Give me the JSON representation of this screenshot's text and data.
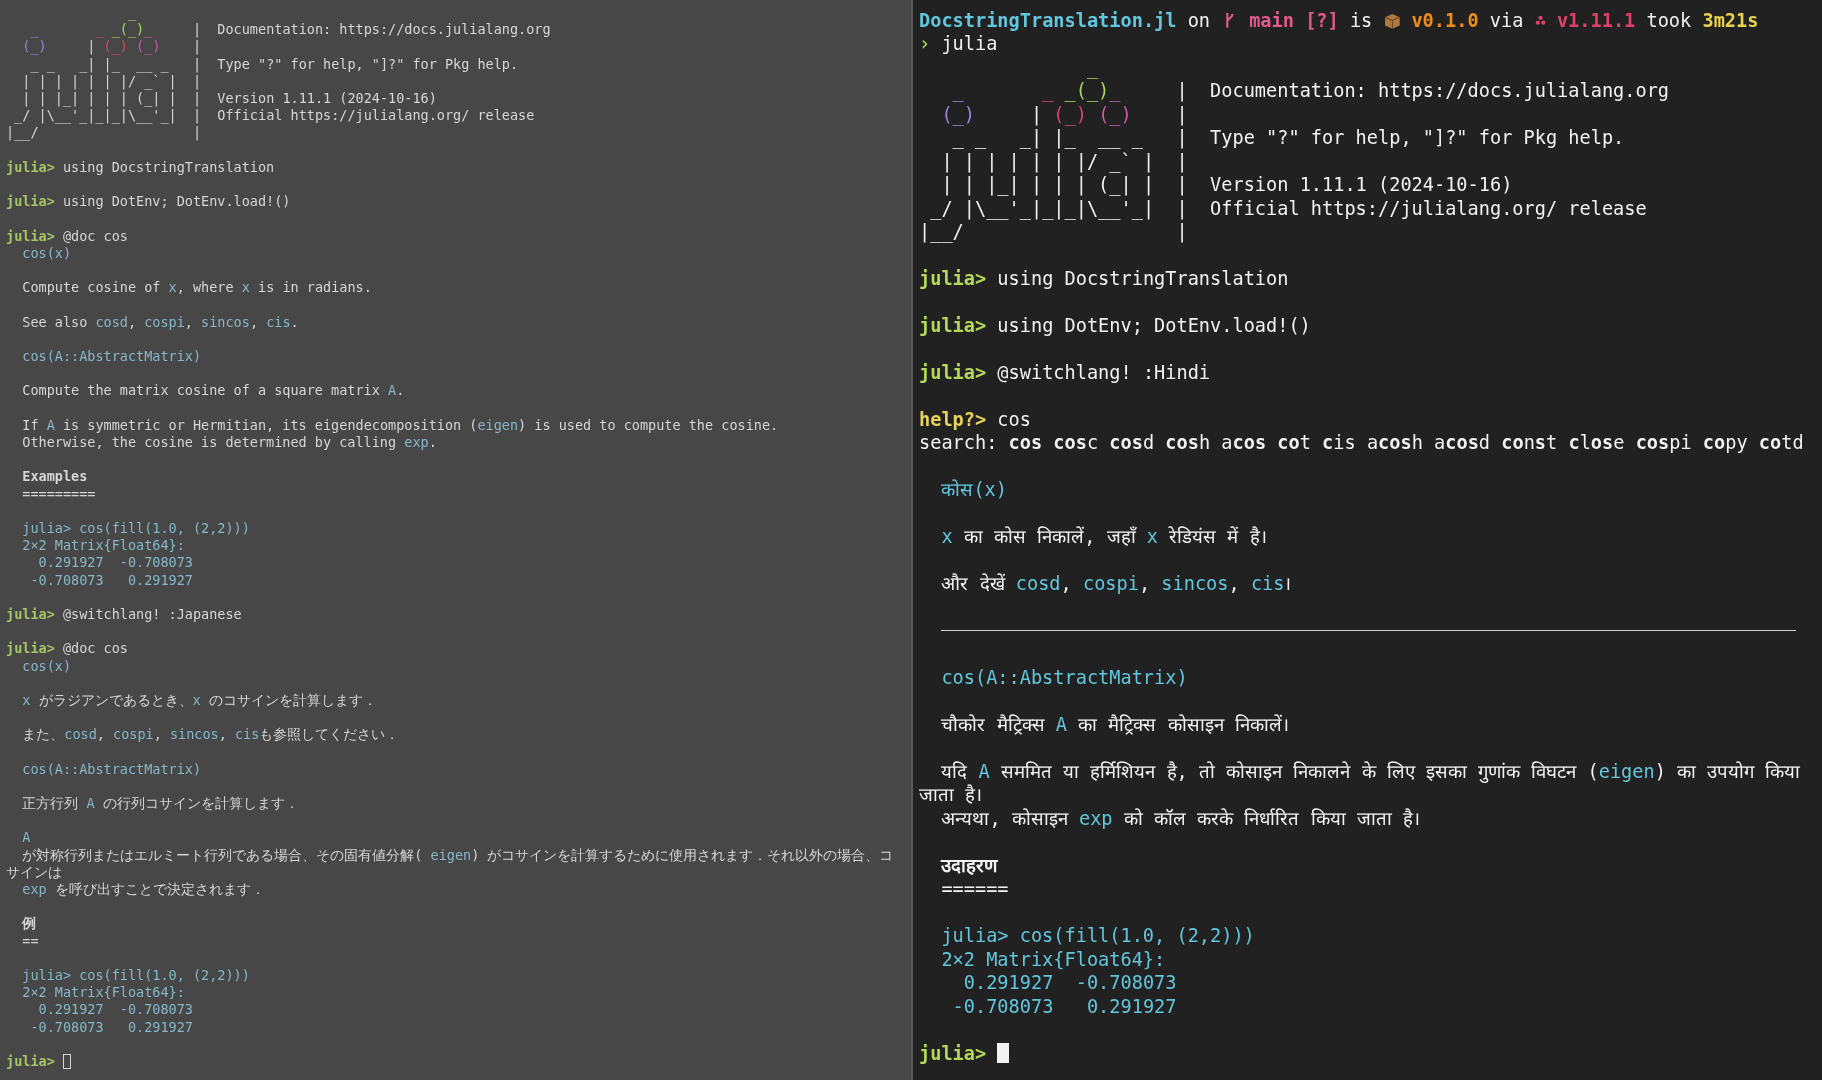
{
  "panes": [
    {
      "focused": false,
      "banner": {
        "art": [
          [
            {
              "kind": "green",
              "text": "               _"
            },
            {
              "kind": "purple",
              "text": "\n   _"
            },
            {
              "kind": "red",
              "text": "       _"
            },
            {
              "kind": "green",
              "text": " _(_)"
            },
            {
              "kind": "magenta",
              "text": "_"
            },
            {
              "kind": "plain",
              "text": "     |"
            }
          ],
          [
            {
              "kind": "purple",
              "text": "  (_)"
            },
            {
              "kind": "plain",
              "text": "     |"
            },
            {
              "kind": "red",
              "text": " (_)"
            },
            {
              "kind": "magenta",
              "text": " (_)"
            },
            {
              "kind": "plain",
              "text": "    |"
            }
          ],
          [
            {
              "kind": "plain",
              "text": "   _ _   _| |_  __ _   |"
            }
          ],
          [
            {
              "kind": "plain",
              "text": "  | | | | | | |/ _` |  |"
            }
          ],
          [
            {
              "kind": "plain",
              "text": "  | | |_| | | | (_| |  |"
            }
          ],
          [
            {
              "kind": "plain",
              "text": " _/ |\\__'_|_|_|\\__'_|  |"
            }
          ],
          [
            {
              "kind": "plain",
              "text": "|__/                   |"
            }
          ]
        ],
        "info": [
          {
            "kind": "blank"
          },
          {
            "kind": "text",
            "text": "Documentation: https://docs.julialang.org"
          },
          {
            "kind": "blank"
          },
          {
            "kind": "text",
            "text": "Type \"?\" for help, \"]?\" for Pkg help."
          },
          {
            "kind": "blank"
          },
          {
            "kind": "text",
            "text": "Version 1.11.1 (2024-10-16)"
          },
          {
            "kind": "text",
            "text": "Official https://julialang.org/ release"
          }
        ]
      },
      "lines": [
        {
          "kind": "blank"
        },
        {
          "kind": "prompt",
          "segs": [
            {
              "kind": "prompt",
              "text": "julia>"
            },
            {
              "kind": "plain",
              "text": " using DocstringTranslation"
            }
          ]
        },
        {
          "kind": "blank"
        },
        {
          "kind": "prompt",
          "segs": [
            {
              "kind": "prompt",
              "text": "julia>"
            },
            {
              "kind": "plain",
              "text": " using DotEnv; DotEnv.load!()"
            }
          ]
        },
        {
          "kind": "blank"
        },
        {
          "kind": "prompt",
          "segs": [
            {
              "kind": "prompt",
              "text": "julia>"
            },
            {
              "kind": "plain",
              "text": " @doc cos"
            }
          ]
        },
        {
          "kind": "code",
          "segs": [
            {
              "kind": "code",
              "text": "cos(x)"
            }
          ]
        },
        {
          "kind": "blank"
        },
        {
          "kind": "doc",
          "segs": [
            {
              "kind": "plain",
              "text": "Compute cosine of "
            },
            {
              "kind": "code",
              "text": "x"
            },
            {
              "kind": "plain",
              "text": ", where "
            },
            {
              "kind": "code",
              "text": "x"
            },
            {
              "kind": "plain",
              "text": " is in radians."
            }
          ]
        },
        {
          "kind": "blank"
        },
        {
          "kind": "doc",
          "segs": [
            {
              "kind": "plain",
              "text": "See also "
            },
            {
              "kind": "code",
              "text": "cosd"
            },
            {
              "kind": "plain",
              "text": ", "
            },
            {
              "kind": "code",
              "text": "cospi"
            },
            {
              "kind": "plain",
              "text": ", "
            },
            {
              "kind": "code",
              "text": "sincos"
            },
            {
              "kind": "plain",
              "text": ", "
            },
            {
              "kind": "code",
              "text": "cis"
            },
            {
              "kind": "plain",
              "text": "."
            }
          ]
        },
        {
          "kind": "blank"
        },
        {
          "kind": "code",
          "segs": [
            {
              "kind": "code",
              "text": "cos(A::AbstractMatrix)"
            }
          ]
        },
        {
          "kind": "blank"
        },
        {
          "kind": "doc",
          "segs": [
            {
              "kind": "plain",
              "text": "Compute the matrix cosine of a square matrix "
            },
            {
              "kind": "code",
              "text": "A"
            },
            {
              "kind": "plain",
              "text": "."
            }
          ]
        },
        {
          "kind": "blank"
        },
        {
          "kind": "doc",
          "segs": [
            {
              "kind": "plain",
              "text": "If "
            },
            {
              "kind": "code",
              "text": "A"
            },
            {
              "kind": "plain",
              "text": " is symmetric or Hermitian, its eigendecomposition ("
            },
            {
              "kind": "code",
              "text": "eigen"
            },
            {
              "kind": "plain",
              "text": ") is used to compute the cosine."
            }
          ]
        },
        {
          "kind": "doc",
          "segs": [
            {
              "kind": "plain",
              "text": "Otherwise, the cosine is determined by calling "
            },
            {
              "kind": "code",
              "text": "exp"
            },
            {
              "kind": "plain",
              "text": "."
            }
          ]
        },
        {
          "kind": "blank"
        },
        {
          "kind": "heading",
          "segs": [
            {
              "kind": "plain",
              "text": "Examples"
            }
          ]
        },
        {
          "kind": "underline",
          "segs": [
            {
              "kind": "plain",
              "text": "========="
            }
          ]
        },
        {
          "kind": "blank"
        },
        {
          "kind": "code",
          "segs": [
            {
              "kind": "code",
              "text": "julia> cos(fill(1.0, (2,2)))"
            }
          ]
        },
        {
          "kind": "code",
          "segs": [
            {
              "kind": "code",
              "text": "2×2 Matrix{Float64}:"
            }
          ]
        },
        {
          "kind": "code",
          "segs": [
            {
              "kind": "code",
              "text": "  0.291927  -0.708073"
            }
          ]
        },
        {
          "kind": "code",
          "segs": [
            {
              "kind": "code",
              "text": " -0.708073   0.291927"
            }
          ]
        },
        {
          "kind": "blank"
        },
        {
          "kind": "prompt",
          "segs": [
            {
              "kind": "prompt",
              "text": "julia>"
            },
            {
              "kind": "plain",
              "text": " @switchlang! :Japanese"
            }
          ]
        },
        {
          "kind": "blank"
        },
        {
          "kind": "prompt",
          "segs": [
            {
              "kind": "prompt",
              "text": "julia>"
            },
            {
              "kind": "plain",
              "text": " @doc cos"
            }
          ]
        },
        {
          "kind": "code",
          "segs": [
            {
              "kind": "code",
              "text": "cos(x)"
            }
          ]
        },
        {
          "kind": "blank"
        },
        {
          "kind": "doc",
          "segs": [
            {
              "kind": "code",
              "text": "x"
            },
            {
              "kind": "plain",
              "text": " がラジアンであるとき、"
            },
            {
              "kind": "code",
              "text": "x"
            },
            {
              "kind": "plain",
              "text": " のコサインを計算します．"
            }
          ]
        },
        {
          "kind": "blank"
        },
        {
          "kind": "doc",
          "segs": [
            {
              "kind": "plain",
              "text": "また、"
            },
            {
              "kind": "code",
              "text": "cosd"
            },
            {
              "kind": "plain",
              "text": ", "
            },
            {
              "kind": "code",
              "text": "cospi"
            },
            {
              "kind": "plain",
              "text": ", "
            },
            {
              "kind": "code",
              "text": "sincos"
            },
            {
              "kind": "plain",
              "text": ", "
            },
            {
              "kind": "code",
              "text": "cis"
            },
            {
              "kind": "plain",
              "text": "も参照してください．"
            }
          ]
        },
        {
          "kind": "blank"
        },
        {
          "kind": "code",
          "segs": [
            {
              "kind": "code",
              "text": "cos(A::AbstractMatrix)"
            }
          ]
        },
        {
          "kind": "blank"
        },
        {
          "kind": "doc",
          "segs": [
            {
              "kind": "plain",
              "text": "正方行列 "
            },
            {
              "kind": "code",
              "text": "A"
            },
            {
              "kind": "plain",
              "text": " の行列コサインを計算します．"
            }
          ]
        },
        {
          "kind": "blank"
        },
        {
          "kind": "code",
          "segs": [
            {
              "kind": "code",
              "text": "A"
            }
          ]
        },
        {
          "kind": "doc",
          "segs": [
            {
              "kind": "plain",
              "text": "が対称行列またはエルミート行列である場合、その固有値分解( "
            },
            {
              "kind": "code",
              "text": "eigen"
            },
            {
              "kind": "plain",
              "text": ") がコサインを計算するために使用されます．それ以外の場合、コサインは"
            }
          ]
        },
        {
          "kind": "doc",
          "segs": [
            {
              "kind": "code",
              "text": "exp"
            },
            {
              "kind": "plain",
              "text": " を呼び出すことで決定されます．"
            }
          ]
        },
        {
          "kind": "blank"
        },
        {
          "kind": "heading",
          "segs": [
            {
              "kind": "plain",
              "text": "例"
            }
          ]
        },
        {
          "kind": "underline",
          "segs": [
            {
              "kind": "plain",
              "text": "=="
            }
          ]
        },
        {
          "kind": "blank"
        },
        {
          "kind": "code",
          "segs": [
            {
              "kind": "code",
              "text": "julia> cos(fill(1.0, (2,2)))"
            }
          ]
        },
        {
          "kind": "code",
          "segs": [
            {
              "kind": "code",
              "text": "2×2 Matrix{Float64}:"
            }
          ]
        },
        {
          "kind": "code",
          "segs": [
            {
              "kind": "code",
              "text": "  0.291927  -0.708073"
            }
          ]
        },
        {
          "kind": "code",
          "segs": [
            {
              "kind": "code",
              "text": " -0.708073   0.291927"
            }
          ]
        },
        {
          "kind": "blank"
        },
        {
          "kind": "input",
          "segs": [
            {
              "kind": "prompt",
              "text": "julia>"
            }
          ]
        }
      ]
    },
    {
      "focused": true,
      "status": {
        "directory": "DocstringTranslation.jl",
        "on_word": "on",
        "branch": "main [?]",
        "is_word": "is",
        "package_version": "v0.1.0",
        "via_word": "via",
        "julia_version": "v1.11.1",
        "took_word": "took",
        "duration": "3m21s"
      },
      "shell": {
        "arrow": "›",
        "command": "julia"
      },
      "banner": {
        "art": [
          [
            {
              "kind": "green",
              "text": "               _"
            },
            {
              "kind": "purple",
              "text": "\n   _"
            },
            {
              "kind": "red",
              "text": "       _"
            },
            {
              "kind": "green",
              "text": " _(_)"
            },
            {
              "kind": "magenta",
              "text": "_"
            },
            {
              "kind": "plain",
              "text": "     |"
            }
          ],
          [
            {
              "kind": "purple",
              "text": "  (_)"
            },
            {
              "kind": "plain",
              "text": "     |"
            },
            {
              "kind": "red",
              "text": " (_)"
            },
            {
              "kind": "magenta",
              "text": " (_)"
            },
            {
              "kind": "plain",
              "text": "    |"
            }
          ],
          [
            {
              "kind": "plain",
              "text": "   _ _   _| |_  __ _   |"
            }
          ],
          [
            {
              "kind": "plain",
              "text": "  | | | | | | |/ _` |  |"
            }
          ],
          [
            {
              "kind": "plain",
              "text": "  | | |_| | | | (_| |  |"
            }
          ],
          [
            {
              "kind": "plain",
              "text": " _/ |\\__'_|_|_|\\__'_|  |"
            }
          ],
          [
            {
              "kind": "plain",
              "text": "|__/                   |"
            }
          ]
        ],
        "info": [
          {
            "kind": "blank"
          },
          {
            "kind": "text",
            "text": "Documentation: https://docs.julialang.org"
          },
          {
            "kind": "blank"
          },
          {
            "kind": "text",
            "text": "Type \"?\" for help, \"]?\" for Pkg help."
          },
          {
            "kind": "blank"
          },
          {
            "kind": "text",
            "text": "Version 1.11.1 (2024-10-16)"
          },
          {
            "kind": "text",
            "text": "Official https://julialang.org/ release"
          }
        ]
      },
      "lines": [
        {
          "kind": "blank"
        },
        {
          "kind": "prompt",
          "segs": [
            {
              "kind": "prompt",
              "text": "julia>"
            },
            {
              "kind": "plain",
              "text": " using DocstringTranslation"
            }
          ]
        },
        {
          "kind": "blank"
        },
        {
          "kind": "prompt",
          "segs": [
            {
              "kind": "prompt",
              "text": "julia>"
            },
            {
              "kind": "plain",
              "text": " using DotEnv; DotEnv.load!()"
            }
          ]
        },
        {
          "kind": "blank"
        },
        {
          "kind": "prompt",
          "segs": [
            {
              "kind": "prompt",
              "text": "julia>"
            },
            {
              "kind": "plain",
              "text": " @switchlang! :Hindi"
            }
          ]
        },
        {
          "kind": "blank"
        },
        {
          "kind": "prompt",
          "segs": [
            {
              "kind": "help",
              "text": "help?>"
            },
            {
              "kind": "plain",
              "text": " cos"
            }
          ]
        },
        {
          "kind": "search",
          "segs": [
            {
              "kind": "plain",
              "text": "search: **cos** **cos**c **cos**d **cos**h a**cos** **co**t **c**is a**cos**h a**cos**d **co**n**s**t **c**l**os**e **cos**pi **co**py **co**td"
            }
          ]
        },
        {
          "kind": "blank"
        },
        {
          "kind": "code",
          "segs": [
            {
              "kind": "code",
              "text": "कोस(x)"
            }
          ]
        },
        {
          "kind": "blank"
        },
        {
          "kind": "doc",
          "segs": [
            {
              "kind": "code",
              "text": "x"
            },
            {
              "kind": "plain",
              "text": " का कोस निकालें, जहाँ "
            },
            {
              "kind": "code",
              "text": "x"
            },
            {
              "kind": "plain",
              "text": " रेडियंस में है।"
            }
          ]
        },
        {
          "kind": "blank"
        },
        {
          "kind": "doc",
          "segs": [
            {
              "kind": "plain",
              "text": "और देखें "
            },
            {
              "kind": "code",
              "text": "cosd"
            },
            {
              "kind": "plain",
              "text": ", "
            },
            {
              "kind": "code",
              "text": "cospi"
            },
            {
              "kind": "plain",
              "text": ", "
            },
            {
              "kind": "code",
              "text": "sincos"
            },
            {
              "kind": "plain",
              "text": ", "
            },
            {
              "kind": "code",
              "text": "cis"
            },
            {
              "kind": "plain",
              "text": "।"
            }
          ]
        },
        {
          "kind": "blank"
        },
        {
          "kind": "rule"
        },
        {
          "kind": "blank"
        },
        {
          "kind": "code",
          "segs": [
            {
              "kind": "code",
              "text": "cos(A::AbstractMatrix)"
            }
          ]
        },
        {
          "kind": "blank"
        },
        {
          "kind": "doc",
          "segs": [
            {
              "kind": "plain",
              "text": "चौकोर मैट्रिक्स "
            },
            {
              "kind": "code",
              "text": "A"
            },
            {
              "kind": "plain",
              "text": " का मैट्रिक्स कोसाइन निकालें।"
            }
          ]
        },
        {
          "kind": "blank"
        },
        {
          "kind": "doc",
          "segs": [
            {
              "kind": "plain",
              "text": "यदि "
            },
            {
              "kind": "code",
              "text": "A"
            },
            {
              "kind": "plain",
              "text": " सममित या हर्मिशियन है, तो कोसाइन निकालने के लिए इसका गुणांक विघटन ("
            },
            {
              "kind": "code",
              "text": "eigen"
            },
            {
              "kind": "plain",
              "text": ") का उपयोग किया जाता है।"
            }
          ]
        },
        {
          "kind": "doc",
          "segs": [
            {
              "kind": "plain",
              "text": "अन्यथा, कोसाइन "
            },
            {
              "kind": "code",
              "text": "exp"
            },
            {
              "kind": "plain",
              "text": " को कॉल करके निर्धारित किया जाता है।"
            }
          ]
        },
        {
          "kind": "blank"
        },
        {
          "kind": "heading",
          "segs": [
            {
              "kind": "plain",
              "text": "उदाहरण"
            }
          ]
        },
        {
          "kind": "underline",
          "segs": [
            {
              "kind": "plain",
              "text": "======"
            }
          ]
        },
        {
          "kind": "blank"
        },
        {
          "kind": "code",
          "segs": [
            {
              "kind": "code",
              "text": "julia> cos(fill(1.0, (2,2)))"
            }
          ]
        },
        {
          "kind": "code",
          "segs": [
            {
              "kind": "code",
              "text": "2×2 Matrix{Float64}:"
            }
          ]
        },
        {
          "kind": "code",
          "segs": [
            {
              "kind": "code",
              "text": "  0.291927  -0.708073"
            }
          ]
        },
        {
          "kind": "code",
          "segs": [
            {
              "kind": "code",
              "text": " -0.708073   0.291927"
            }
          ]
        },
        {
          "kind": "blank"
        },
        {
          "kind": "input",
          "segs": [
            {
              "kind": "prompt",
              "text": "julia>"
            }
          ]
        }
      ]
    }
  ]
}
